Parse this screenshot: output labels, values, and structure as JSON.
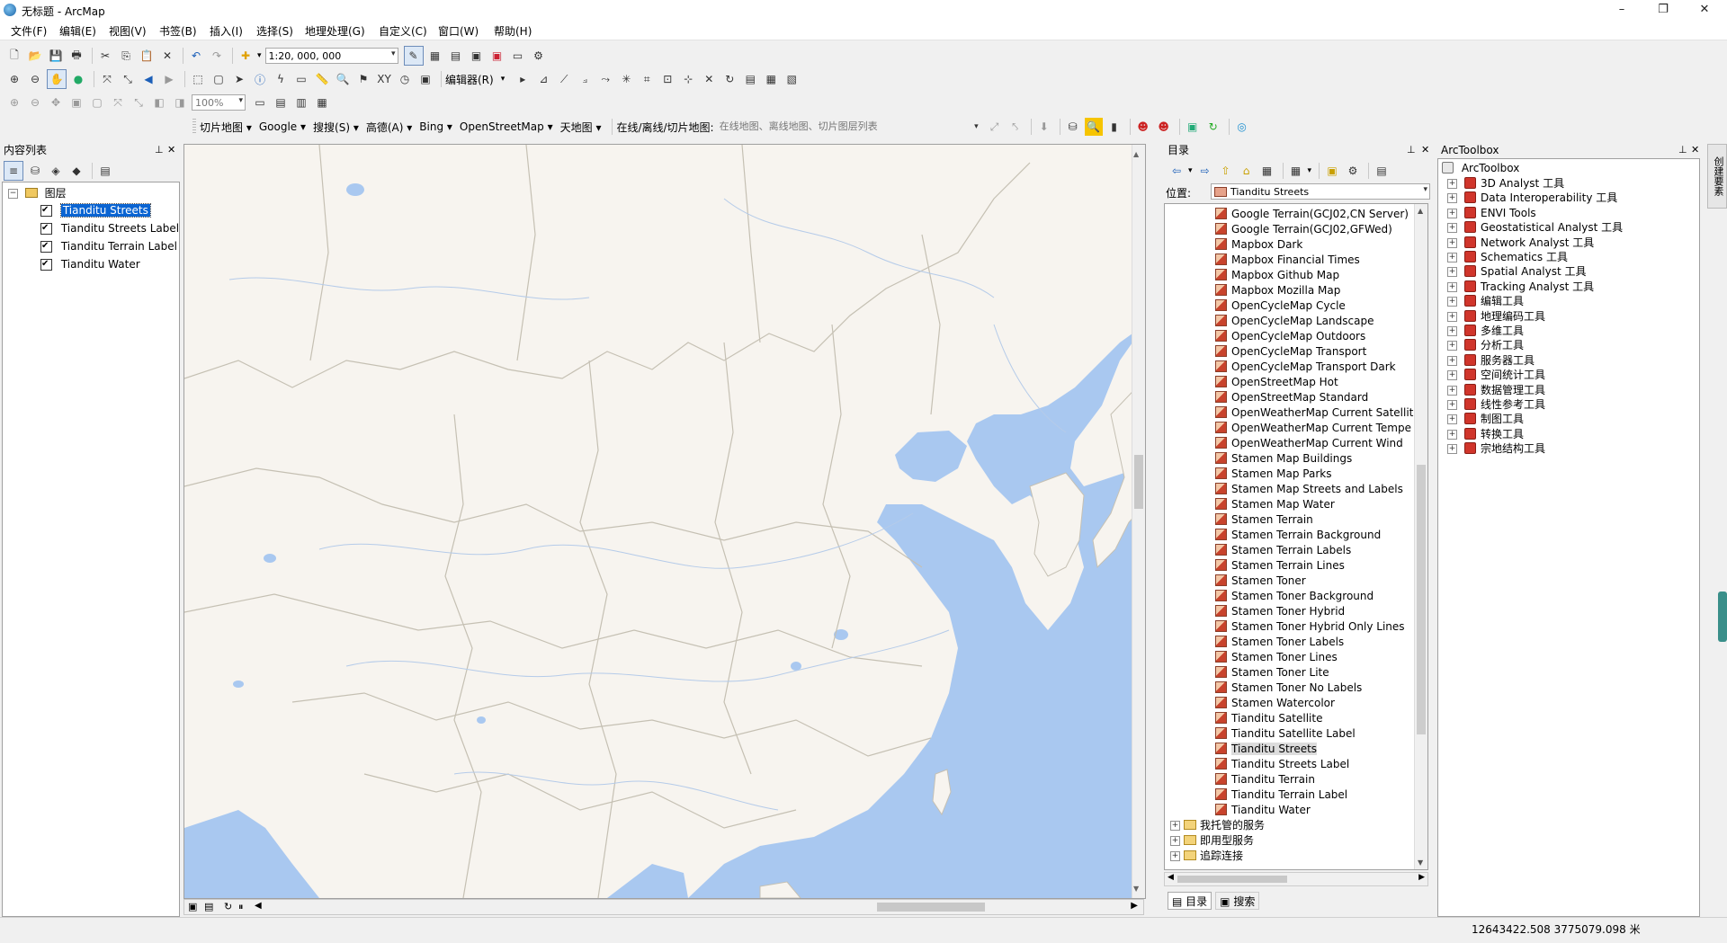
{
  "window": {
    "title": "无标题 - ArcMap",
    "minimize": "–",
    "maximize": "❐",
    "close": "✕"
  },
  "menu": [
    "文件(F)",
    "编辑(E)",
    "视图(V)",
    "书签(B)",
    "插入(I)",
    "选择(S)",
    "地理处理(G)",
    "自定义(C)",
    "窗口(W)",
    "帮助(H)"
  ],
  "toolbar": {
    "scale_value": "1:20, 000, 000",
    "editor_label": "编辑器(R)",
    "zoom_percent": "100%"
  },
  "online_toolbar": {
    "items": [
      "切片地图",
      "Google",
      "搜搜(S)",
      "高德(A)",
      "Bing",
      "OpenStreetMap",
      "天地图"
    ],
    "online_label": "在线/离线/切片地图:",
    "online_placeholder": "在线地图、离线地图、切片图层列表"
  },
  "toc": {
    "title": "内容列表",
    "group_label": "图层",
    "layers": [
      "Tianditu Streets",
      "Tianditu Streets Label",
      "Tianditu Terrain Label",
      "Tianditu Water"
    ]
  },
  "catalog": {
    "title": "目录",
    "location_label": "位置:",
    "location_value": "Tianditu Streets",
    "items": [
      "Google Terrain(GCJ02,CN Server)",
      "Google Terrain(GCJ02,GFWed)",
      "Mapbox Dark",
      "Mapbox Financial Times",
      "Mapbox Github Map",
      "Mapbox Mozilla Map",
      "OpenCycleMap Cycle",
      "OpenCycleMap Landscape",
      "OpenCycleMap Outdoors",
      "OpenCycleMap Transport",
      "OpenCycleMap Transport Dark",
      "OpenStreetMap Hot",
      "OpenStreetMap Standard",
      "OpenWeatherMap Current Satellit",
      "OpenWeatherMap Current Tempe",
      "OpenWeatherMap Current Wind",
      "Stamen Map Buildings",
      "Stamen Map Parks",
      "Stamen Map Streets and Labels",
      "Stamen Map Water",
      "Stamen Terrain",
      "Stamen Terrain Background",
      "Stamen Terrain Labels",
      "Stamen Terrain Lines",
      "Stamen Toner",
      "Stamen Toner Background",
      "Stamen Toner Hybrid",
      "Stamen Toner Hybrid Only Lines",
      "Stamen Toner Labels",
      "Stamen Toner Lines",
      "Stamen Toner Lite",
      "Stamen Toner No Labels",
      "Stamen Watercolor",
      "Tianditu Satellite",
      "Tianditu Satellite Label",
      "Tianditu Streets",
      "Tianditu Streets Label",
      "Tianditu Terrain",
      "Tianditu Terrain Label",
      "Tianditu Water"
    ],
    "selected": "Tianditu Streets",
    "folders": [
      "我托管的服务",
      "即用型服务",
      "追踪连接"
    ],
    "tabs": [
      "目录",
      "搜索"
    ]
  },
  "toolbox": {
    "title": "ArcToolbox",
    "root": "ArcToolbox",
    "tools": [
      "3D Analyst 工具",
      "Data Interoperability 工具",
      "ENVI Tools",
      "Geostatistical Analyst 工具",
      "Network Analyst 工具",
      "Schematics 工具",
      "Spatial Analyst 工具",
      "Tracking Analyst 工具",
      "编辑工具",
      "地理编码工具",
      "多维工具",
      "分析工具",
      "服务器工具",
      "空间统计工具",
      "数据管理工具",
      "线性参考工具",
      "制图工具",
      "转换工具",
      "宗地结构工具"
    ],
    "side_tab": "创建要素"
  },
  "status": {
    "coordinates": "12643422.508  3775079.098 米"
  },
  "colors": {
    "water": "#a9c8f0",
    "land": "#f7f4ef",
    "border": "#c5c0b3",
    "river": "#b5cbe9",
    "selection": "#0a64d2"
  }
}
